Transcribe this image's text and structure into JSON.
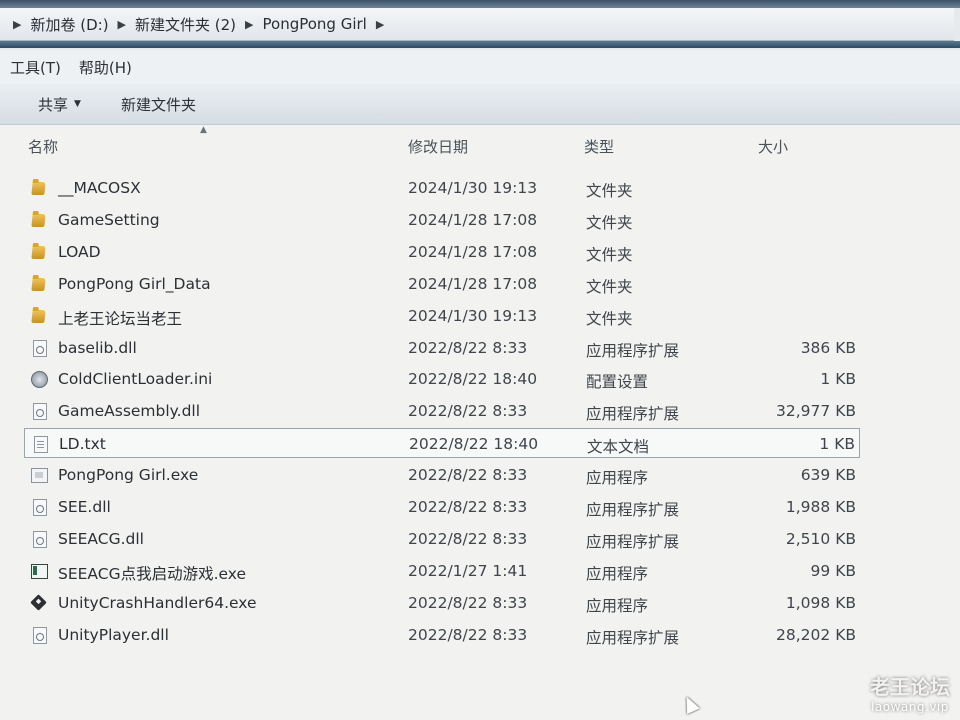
{
  "breadcrumb": {
    "items": [
      "新加卷 (D:)",
      "新建文件夹 (2)",
      "PongPong Girl"
    ]
  },
  "menu": {
    "items": [
      "工具(T)",
      "帮助(H)"
    ]
  },
  "toolbar": {
    "share_label": "共享",
    "new_folder_label": "新建文件夹"
  },
  "columns": {
    "name": "名称",
    "date": "修改日期",
    "type": "类型",
    "size": "大小"
  },
  "files": [
    {
      "name": "__MACOSX",
      "date": "2024/1/30 19:13",
      "type": "文件夹",
      "size": "",
      "icon": "folder-icon"
    },
    {
      "name": "GameSetting",
      "date": "2024/1/28 17:08",
      "type": "文件夹",
      "size": "",
      "icon": "folder-icon"
    },
    {
      "name": "LOAD",
      "date": "2024/1/28 17:08",
      "type": "文件夹",
      "size": "",
      "icon": "folder-icon"
    },
    {
      "name": "PongPong Girl_Data",
      "date": "2024/1/28 17:08",
      "type": "文件夹",
      "size": "",
      "icon": "folder-icon"
    },
    {
      "name": "上老王论坛当老王",
      "date": "2024/1/30 19:13",
      "type": "文件夹",
      "size": "",
      "icon": "folder-icon"
    },
    {
      "name": "baselib.dll",
      "date": "2022/8/22 8:33",
      "type": "应用程序扩展",
      "size": "386 KB",
      "icon": "dll-icon"
    },
    {
      "name": "ColdClientLoader.ini",
      "date": "2022/8/22 18:40",
      "type": "配置设置",
      "size": "1 KB",
      "icon": "ini-settings-icon"
    },
    {
      "name": "GameAssembly.dll",
      "date": "2022/8/22 8:33",
      "type": "应用程序扩展",
      "size": "32,977 KB",
      "icon": "dll-icon"
    },
    {
      "name": "LD.txt",
      "date": "2022/8/22 18:40",
      "type": "文本文档",
      "size": "1 KB",
      "icon": "text-file-icon",
      "selected": true
    },
    {
      "name": "PongPong Girl.exe",
      "date": "2022/8/22 8:33",
      "type": "应用程序",
      "size": "639 KB",
      "icon": "exe-icon"
    },
    {
      "name": "SEE.dll",
      "date": "2022/8/22 8:33",
      "type": "应用程序扩展",
      "size": "1,988 KB",
      "icon": "dll-icon"
    },
    {
      "name": "SEEACG.dll",
      "date": "2022/8/22 8:33",
      "type": "应用程序扩展",
      "size": "2,510 KB",
      "icon": "dll-icon"
    },
    {
      "name": "SEEACG点我启动游戏.exe",
      "date": "2022/1/27 1:41",
      "type": "应用程序",
      "size": "99 KB",
      "icon": "app-window-icon"
    },
    {
      "name": "UnityCrashHandler64.exe",
      "date": "2022/8/22 8:33",
      "type": "应用程序",
      "size": "1,098 KB",
      "icon": "unity-icon"
    },
    {
      "name": "UnityPlayer.dll",
      "date": "2022/8/22 8:33",
      "type": "应用程序扩展",
      "size": "28,202 KB",
      "icon": "dll-icon"
    }
  ],
  "watermark": {
    "main": "老王论坛",
    "sub": "laowang.vip"
  }
}
